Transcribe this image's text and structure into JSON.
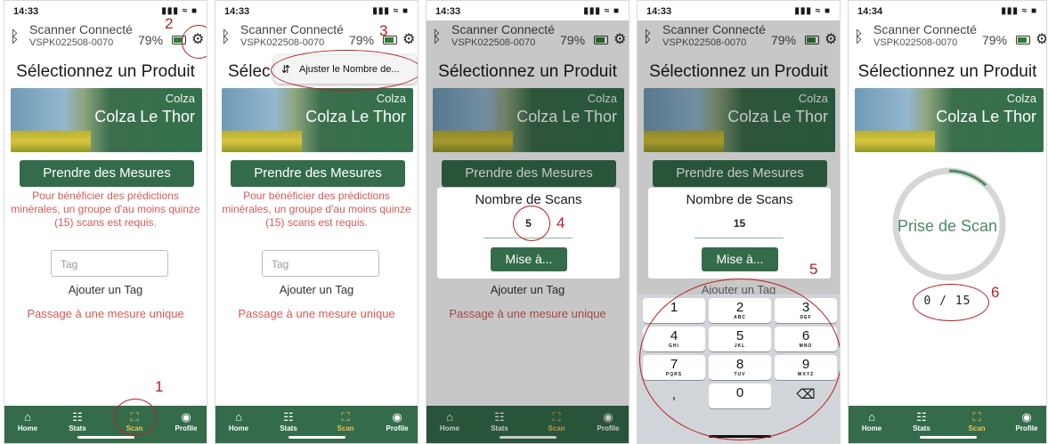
{
  "status": {
    "time1": "14:33",
    "time2": "14:34",
    "icons": "▮▮▮ ≈ ■"
  },
  "header": {
    "bluetooth_icon": "bluetooth-icon",
    "connected": "Scanner Connecté",
    "serial": "VSPK022508-0070",
    "battery": "79%",
    "settings_icon": "gear-icon"
  },
  "page": {
    "title": "Sélectionnez un Produit",
    "title_partial": "Sélec"
  },
  "product": {
    "crop": "Colza",
    "name": "Colza Le Thor"
  },
  "measure": {
    "button": "Prendre des Mesures",
    "info": "Pour bénéficier des prédictions minérales, un groupe d'au moins quinze (15) scans est requis."
  },
  "tag": {
    "placeholder": "Tag",
    "add": "Ajouter un Tag",
    "single": "Passage à une mesure unique"
  },
  "popup": {
    "label": "Ajuster le Nombre de...",
    "icon": "adjust-icon"
  },
  "dialog": {
    "title": "Nombre de Scans",
    "value_a": "5",
    "value_b": "15",
    "button": "Mise à..."
  },
  "keypad": {
    "keys": [
      {
        "d": "1",
        "l": ""
      },
      {
        "d": "2",
        "l": "ABC"
      },
      {
        "d": "3",
        "l": "DEF"
      },
      {
        "d": "4",
        "l": "GHI"
      },
      {
        "d": "5",
        "l": "JKL"
      },
      {
        "d": "6",
        "l": "MNO"
      },
      {
        "d": "7",
        "l": "PQRS"
      },
      {
        "d": "8",
        "l": "TUV"
      },
      {
        "d": "9",
        "l": "WXYZ"
      },
      {
        "d": ",",
        "l": ""
      },
      {
        "d": "0",
        "l": ""
      },
      {
        "d": "⌫",
        "l": ""
      }
    ]
  },
  "scan": {
    "label": "Prise de Scan",
    "counter": "0 / 15",
    "progress": 0.12
  },
  "nav": {
    "home": "Home",
    "stats": "Stats",
    "scan": "Scan",
    "profile": "Profile"
  },
  "annotations": {
    "n1": "1",
    "n2": "2",
    "n3": "3",
    "n4": "4",
    "n5": "5",
    "n6": "6"
  },
  "colors": {
    "primary": "#346c4b",
    "accent": "#f2c24e",
    "warning": "#d45a5a",
    "annotation": "#b22222"
  }
}
